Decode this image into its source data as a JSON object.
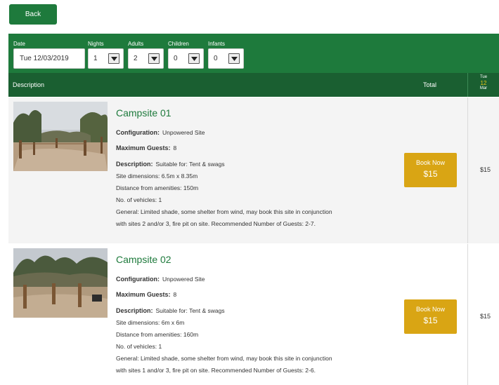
{
  "back_label": "Back",
  "filters": {
    "date": {
      "label": "Date",
      "value": "Tue 12/03/2019"
    },
    "nights": {
      "label": "Nights",
      "value": "1"
    },
    "adults": {
      "label": "Adults",
      "value": "2"
    },
    "children": {
      "label": "Children",
      "value": "0"
    },
    "infants": {
      "label": "Infants",
      "value": "0"
    }
  },
  "header": {
    "description": "Description",
    "total": "Total",
    "date_dow": "Tue",
    "date_day": "12",
    "date_month": "Mar"
  },
  "colors": {
    "brand_green": "#1e7a3c",
    "header_green": "#1a5f31",
    "book_gold": "#d9a514",
    "day_yellow": "#e8c61a"
  },
  "sites": [
    {
      "title": "Campsite 01",
      "configuration_label": "Configuration:",
      "configuration": "Unpowered Site",
      "max_guests_label": "Maximum Guests:",
      "max_guests": "8",
      "description_label": "Description:",
      "description": "Suitable for: Tent & swags",
      "dimensions": "Site dimensions: 6.5m x 8.35m",
      "distance": "Distance from amenities: 150m",
      "vehicles": "No. of vehicles: 1",
      "general_1": "General: Limited shade, some shelter from wind, may book this site in conjunction",
      "general_2": "with sites 2 and/or 3, fire pit on site. Recommended Number of Guests: 2-7.",
      "book_label": "Book Now",
      "book_price": "$15",
      "price": "$15"
    },
    {
      "title": "Campsite 02",
      "configuration_label": "Configuration:",
      "configuration": "Unpowered Site",
      "max_guests_label": "Maximum Guests:",
      "max_guests": "8",
      "description_label": "Description:",
      "description": "Suitable for: Tent & swags",
      "dimensions": "Site dimensions: 6m x 6m",
      "distance": "Distance from amenities: 160m",
      "vehicles": "No. of vehicles: 1",
      "general_1": "General: Limited shade, some shelter from wind, may book this site in conjunction",
      "general_2": "with sites 1 and/or 3, fire pit on site. Recommended Number of Guests: 2-6.",
      "book_label": "Book Now",
      "book_price": "$15",
      "price": "$15"
    }
  ]
}
